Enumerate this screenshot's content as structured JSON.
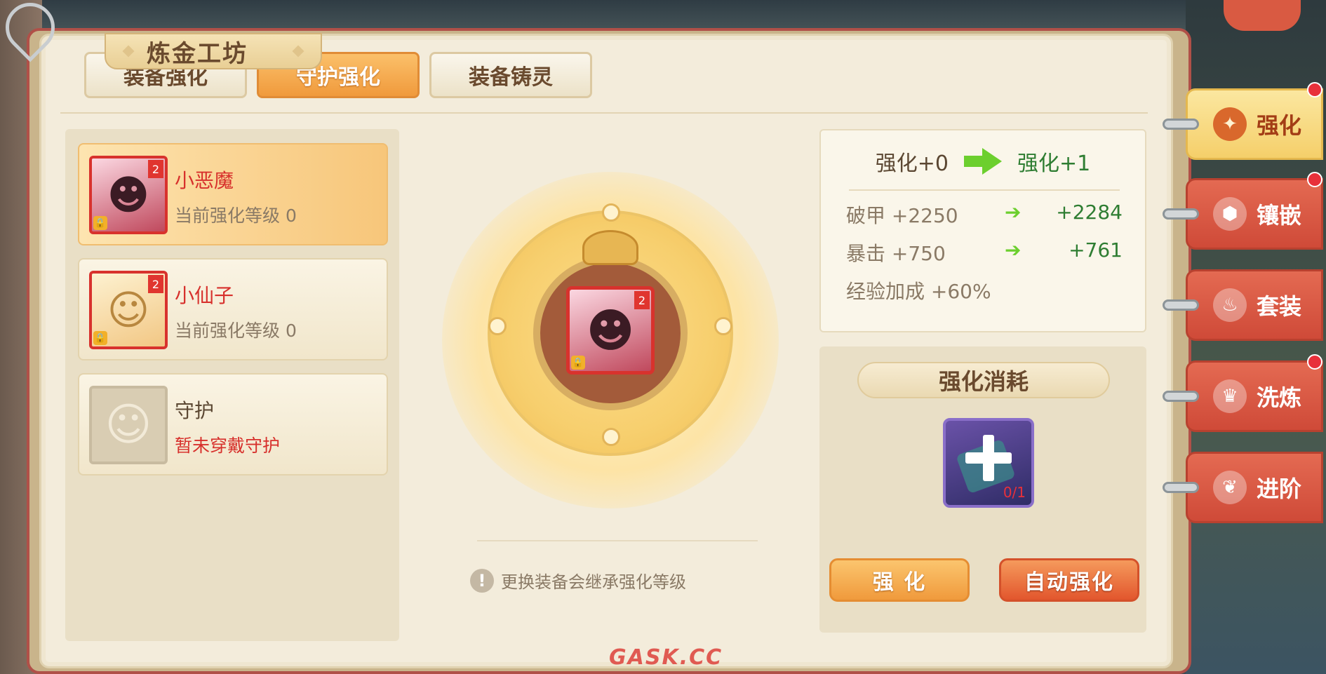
{
  "window": {
    "title": "炼金工坊"
  },
  "tabs": [
    {
      "label": "装备强化",
      "active": false,
      "has_dot": true
    },
    {
      "label": "守护强化",
      "active": true,
      "has_dot": false
    },
    {
      "label": "装备铸灵",
      "active": false,
      "has_dot": false
    }
  ],
  "list": [
    {
      "name": "小恶魔",
      "sub": "当前强化等级 0",
      "level_badge": "2",
      "selected": true,
      "icon": "imp-avatar-icon"
    },
    {
      "name": "小仙子",
      "sub": "当前强化等级 0",
      "level_badge": "2",
      "selected": false,
      "icon": "fairy-avatar-icon"
    },
    {
      "name": "守护",
      "sub": "暂未穿戴守护",
      "level_badge": "",
      "selected": false,
      "icon": "empty-guardian-icon"
    }
  ],
  "center": {
    "avatar_badge": "2",
    "tip": "更换装备会继承强化等级"
  },
  "stats": {
    "from": "强化+0",
    "to": "强化+1",
    "rows": [
      {
        "label": "破甲 +2250",
        "value": "+2284"
      },
      {
        "label": "暴击 +750",
        "value": "+761"
      },
      {
        "label": "经验加成 +60%",
        "value": ""
      }
    ]
  },
  "cost": {
    "title": "强化消耗",
    "item_count": "0/1",
    "enhance_label": "强 化",
    "auto_label": "自动强化"
  },
  "side_nav": [
    {
      "label": "强化",
      "icon": "compass-icon",
      "active": true,
      "dot": true
    },
    {
      "label": "镶嵌",
      "icon": "hexagon-gem-icon",
      "active": false,
      "dot": true
    },
    {
      "label": "套装",
      "icon": "flame-icon",
      "active": false,
      "dot": false
    },
    {
      "label": "洗炼",
      "icon": "crown-icon",
      "active": false,
      "dot": true
    },
    {
      "label": "进阶",
      "icon": "wings-icon",
      "active": false,
      "dot": false
    }
  ],
  "watermark": "GASK.CC",
  "colors": {
    "accent_orange": "#f09a3c",
    "alert_red": "#d7302c",
    "stat_green": "#2e7d32",
    "arrow_green": "#6ccf2e"
  }
}
